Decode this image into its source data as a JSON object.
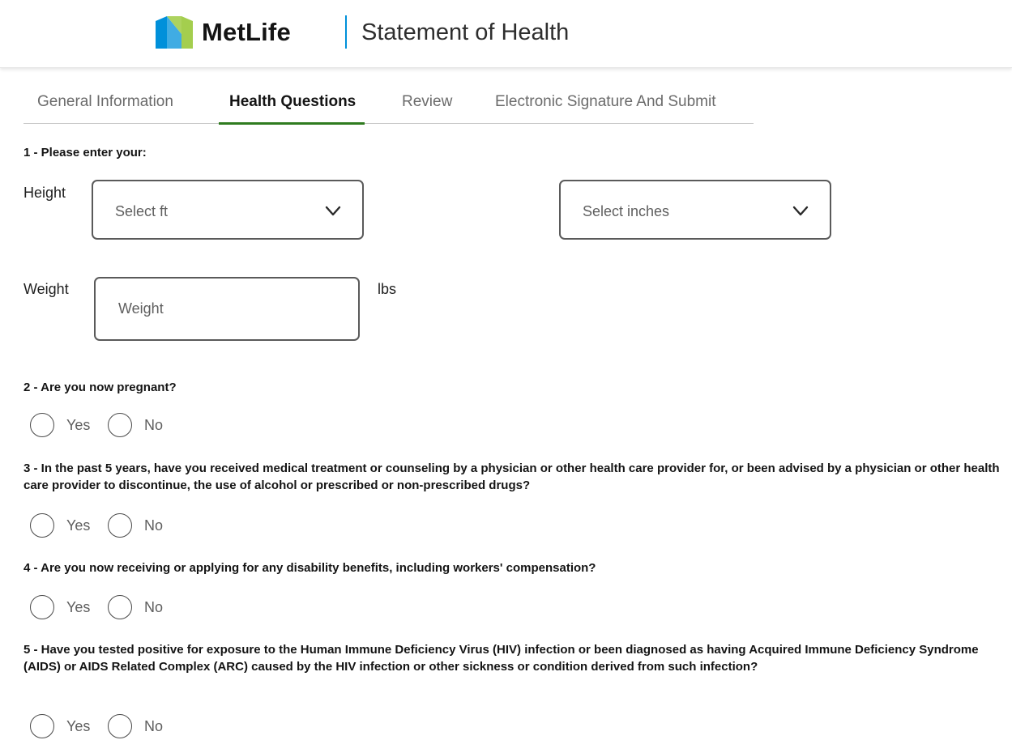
{
  "header": {
    "brand_name": "MetLife",
    "app_title": "Statement of Health",
    "logo_icon": "metlife-logo-icon",
    "colors": {
      "logo_blue": "#0090da",
      "logo_green": "#a4ce4e",
      "divider": "#0090da"
    }
  },
  "tabs": [
    {
      "label": "General Information",
      "active": false
    },
    {
      "label": "Health Questions",
      "active": true
    },
    {
      "label": "Review",
      "active": false
    },
    {
      "label": "Electronic Signature And Submit",
      "active": false
    }
  ],
  "accent_color": "#2f7b1f",
  "q1": {
    "title": "1 - Please enter your:",
    "height_label": "Height",
    "feet_select": {
      "placeholder": "Select ft",
      "icon": "chevron-down-icon"
    },
    "inches_select": {
      "placeholder": "Select inches",
      "icon": "chevron-down-icon"
    },
    "weight_label": "Weight",
    "weight_input": {
      "placeholder": "Weight",
      "value": ""
    },
    "weight_unit": "lbs"
  },
  "questions": [
    {
      "title": "2 - Are you now pregnant?",
      "options": [
        "Yes",
        "No"
      ]
    },
    {
      "title": "3 - In the past 5 years, have you received medical treatment or counseling by a physician or other health care provider for, or been advised by a physician or other health care provider to discontinue, the use of alcohol or prescribed or non-prescribed drugs?",
      "options": [
        "Yes",
        "No"
      ]
    },
    {
      "title": "4 - Are you now receiving or applying for any disability benefits, including workers' compensation?",
      "options": [
        "Yes",
        "No"
      ]
    },
    {
      "title": "5 - Have you tested positive for exposure to the Human Immune Deficiency Virus (HIV) infection or been diagnosed as having Acquired Immune Deficiency Syndrome (AIDS) or AIDS Related Complex (ARC) caused by the HIV infection or other sickness or condition derived from such infection?",
      "options": [
        "Yes",
        "No"
      ]
    }
  ]
}
